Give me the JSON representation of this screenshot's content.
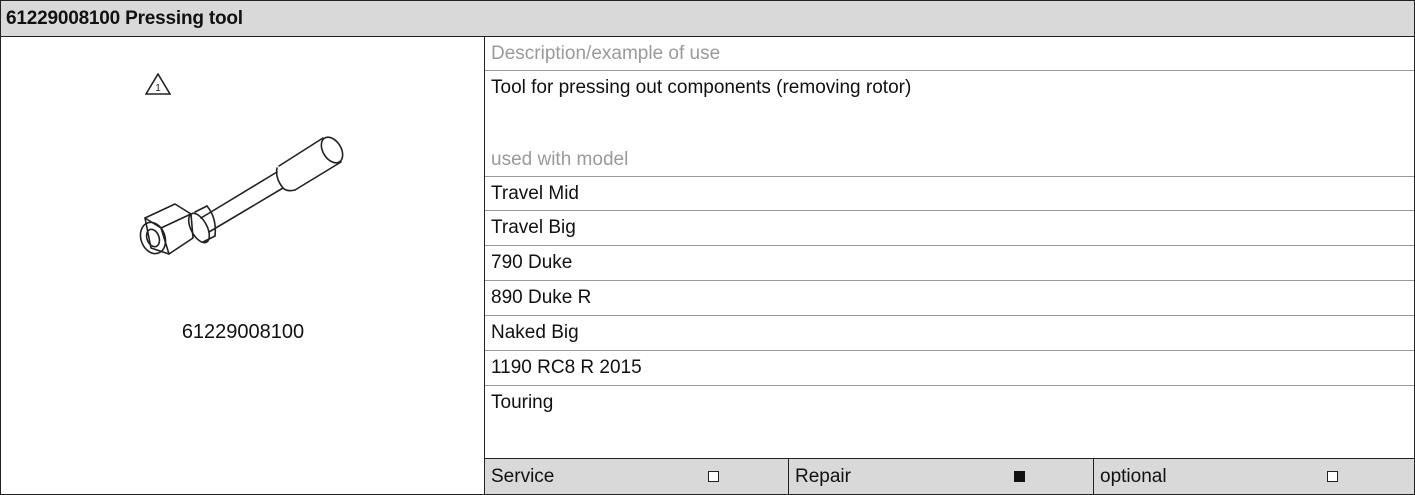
{
  "title": "61229008100 Pressing tool",
  "image_panel": {
    "part_number": "61229008100",
    "warning_icon": "warning-triangle-1-icon",
    "tool_illustration": "pressing-tool-drawing"
  },
  "info": {
    "description_label": "Description/example of use",
    "description": "Tool for pressing out components (removing rotor)",
    "models_label": "used with model",
    "models": [
      "Travel Mid",
      "Travel Big",
      "790 Duke",
      "890 Duke R",
      "Naked Big",
      "1190 RC8 R 2015",
      "Touring"
    ]
  },
  "footer": [
    {
      "label": "Service",
      "checked": false
    },
    {
      "label": "Repair",
      "checked": true
    },
    {
      "label": "optional",
      "checked": false
    }
  ]
}
